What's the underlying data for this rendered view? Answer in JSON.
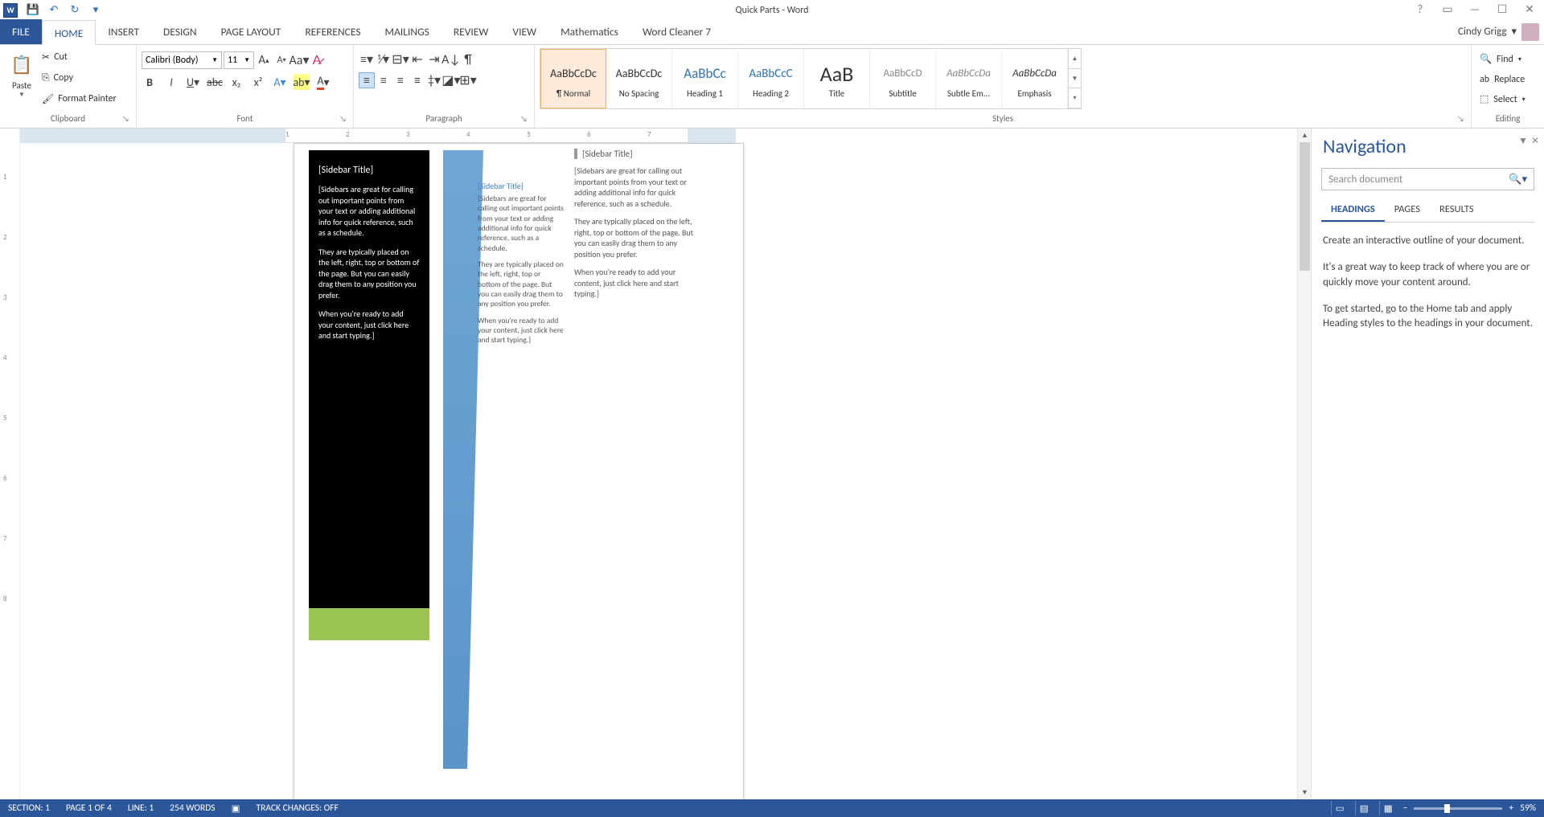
{
  "app_title": "Quick Parts - Word",
  "account_name": "Cindy Grigg",
  "tabs": {
    "file": "FILE",
    "home": "HOME",
    "insert": "INSERT",
    "design": "DESIGN",
    "page_layout": "PAGE LAYOUT",
    "references": "REFERENCES",
    "mailings": "MAILINGS",
    "review": "REVIEW",
    "view": "VIEW",
    "math": "Mathematics",
    "cleaner": "Word Cleaner 7"
  },
  "clipboard": {
    "paste": "Paste",
    "cut": "Cut",
    "copy": "Copy",
    "format_painter": "Format Painter",
    "label": "Clipboard"
  },
  "font": {
    "name": "Calibri (Body)",
    "size": "11",
    "label": "Font"
  },
  "paragraph": {
    "label": "Paragraph"
  },
  "styles": {
    "label": "Styles",
    "items": [
      {
        "preview": "AaBbCcDc",
        "name": "¶ Normal",
        "color": "#333",
        "size": "14px",
        "sel": true
      },
      {
        "preview": "AaBbCcDc",
        "name": "No Spacing",
        "color": "#333",
        "size": "14px"
      },
      {
        "preview": "AaBbCc",
        "name": "Heading 1",
        "color": "#2e74b5",
        "size": "17px"
      },
      {
        "preview": "AaBbCcC",
        "name": "Heading 2",
        "color": "#2e74b5",
        "size": "15px"
      },
      {
        "preview": "AaB",
        "name": "Title",
        "color": "#333",
        "size": "26px"
      },
      {
        "preview": "AaBbCcD",
        "name": "Subtitle",
        "color": "#888",
        "size": "13px"
      },
      {
        "preview": "AaBbCcDa",
        "name": "Subtle Em...",
        "color": "#888",
        "size": "13px",
        "italic": true
      },
      {
        "preview": "AaBbCcDa",
        "name": "Emphasis",
        "color": "#333",
        "size": "13px",
        "italic": true
      }
    ]
  },
  "editing": {
    "find": "Find",
    "replace": "Replace",
    "select": "Select",
    "label": "Editing"
  },
  "navpane": {
    "title": "Navigation",
    "search_placeholder": "Search document",
    "tabs": {
      "headings": "HEADINGS",
      "pages": "PAGES",
      "results": "RESULTS"
    },
    "body": [
      "Create an interactive outline of your document.",
      "It's a great way to keep track of where you are or quickly move your content around.",
      "To get started, go to the Home tab and apply Heading styles to the headings in your document."
    ]
  },
  "doc": {
    "sidebar_title": "[Sidebar Title]",
    "p1": "[Sidebars are great for calling out important points from your text or adding additional info for quick reference, such as a schedule.",
    "p2": "They are typically placed on the left, right, top or bottom of the page. But you can easily drag them to any position you prefer.",
    "p3": "When you're ready to add your content, just click here and start typing.]"
  },
  "status": {
    "section": "SECTION: 1",
    "page": "PAGE 1 OF 4",
    "line": "LINE: 1",
    "words": "254 WORDS",
    "track": "TRACK CHANGES: OFF",
    "zoom": "59%"
  },
  "hruler_ticks": [
    "1",
    "2",
    "3",
    "4",
    "5",
    "6",
    "7"
  ],
  "vruler_ticks": [
    "1",
    "2",
    "3",
    "4",
    "5",
    "6",
    "7",
    "8"
  ]
}
